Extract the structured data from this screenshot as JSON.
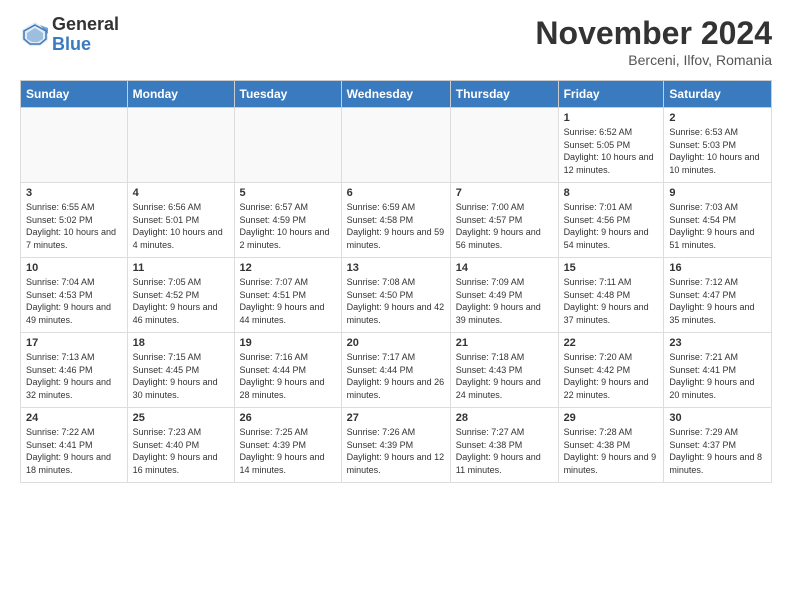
{
  "logo": {
    "general": "General",
    "blue": "Blue"
  },
  "title": "November 2024",
  "location": "Berceni, Ilfov, Romania",
  "headers": [
    "Sunday",
    "Monday",
    "Tuesday",
    "Wednesday",
    "Thursday",
    "Friday",
    "Saturday"
  ],
  "weeks": [
    [
      {
        "day": "",
        "info": ""
      },
      {
        "day": "",
        "info": ""
      },
      {
        "day": "",
        "info": ""
      },
      {
        "day": "",
        "info": ""
      },
      {
        "day": "",
        "info": ""
      },
      {
        "day": "1",
        "info": "Sunrise: 6:52 AM\nSunset: 5:05 PM\nDaylight: 10 hours and 12 minutes."
      },
      {
        "day": "2",
        "info": "Sunrise: 6:53 AM\nSunset: 5:03 PM\nDaylight: 10 hours and 10 minutes."
      }
    ],
    [
      {
        "day": "3",
        "info": "Sunrise: 6:55 AM\nSunset: 5:02 PM\nDaylight: 10 hours and 7 minutes."
      },
      {
        "day": "4",
        "info": "Sunrise: 6:56 AM\nSunset: 5:01 PM\nDaylight: 10 hours and 4 minutes."
      },
      {
        "day": "5",
        "info": "Sunrise: 6:57 AM\nSunset: 4:59 PM\nDaylight: 10 hours and 2 minutes."
      },
      {
        "day": "6",
        "info": "Sunrise: 6:59 AM\nSunset: 4:58 PM\nDaylight: 9 hours and 59 minutes."
      },
      {
        "day": "7",
        "info": "Sunrise: 7:00 AM\nSunset: 4:57 PM\nDaylight: 9 hours and 56 minutes."
      },
      {
        "day": "8",
        "info": "Sunrise: 7:01 AM\nSunset: 4:56 PM\nDaylight: 9 hours and 54 minutes."
      },
      {
        "day": "9",
        "info": "Sunrise: 7:03 AM\nSunset: 4:54 PM\nDaylight: 9 hours and 51 minutes."
      }
    ],
    [
      {
        "day": "10",
        "info": "Sunrise: 7:04 AM\nSunset: 4:53 PM\nDaylight: 9 hours and 49 minutes."
      },
      {
        "day": "11",
        "info": "Sunrise: 7:05 AM\nSunset: 4:52 PM\nDaylight: 9 hours and 46 minutes."
      },
      {
        "day": "12",
        "info": "Sunrise: 7:07 AM\nSunset: 4:51 PM\nDaylight: 9 hours and 44 minutes."
      },
      {
        "day": "13",
        "info": "Sunrise: 7:08 AM\nSunset: 4:50 PM\nDaylight: 9 hours and 42 minutes."
      },
      {
        "day": "14",
        "info": "Sunrise: 7:09 AM\nSunset: 4:49 PM\nDaylight: 9 hours and 39 minutes."
      },
      {
        "day": "15",
        "info": "Sunrise: 7:11 AM\nSunset: 4:48 PM\nDaylight: 9 hours and 37 minutes."
      },
      {
        "day": "16",
        "info": "Sunrise: 7:12 AM\nSunset: 4:47 PM\nDaylight: 9 hours and 35 minutes."
      }
    ],
    [
      {
        "day": "17",
        "info": "Sunrise: 7:13 AM\nSunset: 4:46 PM\nDaylight: 9 hours and 32 minutes."
      },
      {
        "day": "18",
        "info": "Sunrise: 7:15 AM\nSunset: 4:45 PM\nDaylight: 9 hours and 30 minutes."
      },
      {
        "day": "19",
        "info": "Sunrise: 7:16 AM\nSunset: 4:44 PM\nDaylight: 9 hours and 28 minutes."
      },
      {
        "day": "20",
        "info": "Sunrise: 7:17 AM\nSunset: 4:44 PM\nDaylight: 9 hours and 26 minutes."
      },
      {
        "day": "21",
        "info": "Sunrise: 7:18 AM\nSunset: 4:43 PM\nDaylight: 9 hours and 24 minutes."
      },
      {
        "day": "22",
        "info": "Sunrise: 7:20 AM\nSunset: 4:42 PM\nDaylight: 9 hours and 22 minutes."
      },
      {
        "day": "23",
        "info": "Sunrise: 7:21 AM\nSunset: 4:41 PM\nDaylight: 9 hours and 20 minutes."
      }
    ],
    [
      {
        "day": "24",
        "info": "Sunrise: 7:22 AM\nSunset: 4:41 PM\nDaylight: 9 hours and 18 minutes."
      },
      {
        "day": "25",
        "info": "Sunrise: 7:23 AM\nSunset: 4:40 PM\nDaylight: 9 hours and 16 minutes."
      },
      {
        "day": "26",
        "info": "Sunrise: 7:25 AM\nSunset: 4:39 PM\nDaylight: 9 hours and 14 minutes."
      },
      {
        "day": "27",
        "info": "Sunrise: 7:26 AM\nSunset: 4:39 PM\nDaylight: 9 hours and 12 minutes."
      },
      {
        "day": "28",
        "info": "Sunrise: 7:27 AM\nSunset: 4:38 PM\nDaylight: 9 hours and 11 minutes."
      },
      {
        "day": "29",
        "info": "Sunrise: 7:28 AM\nSunset: 4:38 PM\nDaylight: 9 hours and 9 minutes."
      },
      {
        "day": "30",
        "info": "Sunrise: 7:29 AM\nSunset: 4:37 PM\nDaylight: 9 hours and 8 minutes."
      }
    ]
  ]
}
